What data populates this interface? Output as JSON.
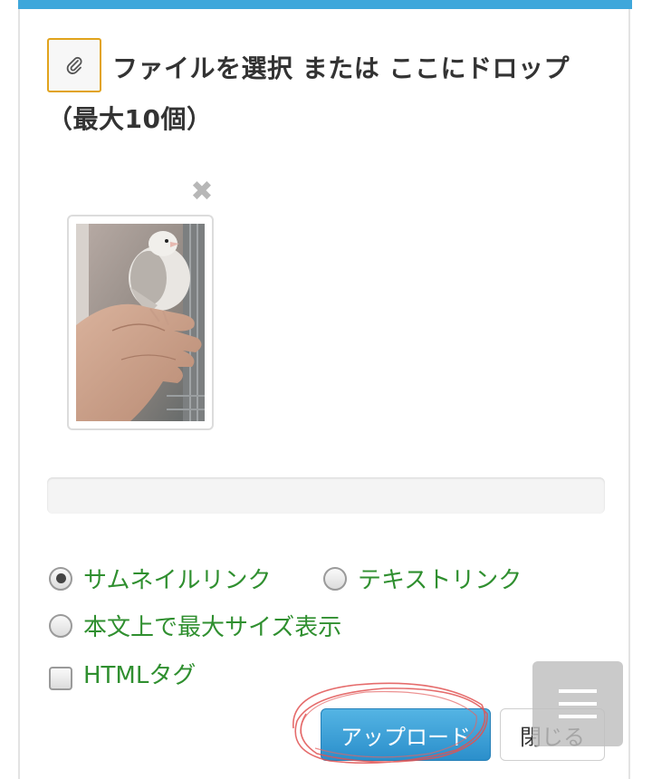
{
  "uploader": {
    "drop_text": "ファイルを選択 または ここにドロップ（最大10個）",
    "attach_icon": "paperclip-icon",
    "thumbnails": [
      {
        "remove_label": "✖",
        "image_alt": "bird-on-hand-photo"
      }
    ],
    "progress": 0
  },
  "options": {
    "thumbnail_link": {
      "label": "サムネイルリンク",
      "checked": true
    },
    "text_link": {
      "label": "テキストリンク",
      "checked": false
    },
    "max_size_display": {
      "label": "本文上で最大サイズ表示",
      "checked": false
    },
    "html_tag": {
      "label": "HTMLタグ",
      "checked": false
    }
  },
  "buttons": {
    "upload_label": "アップロード",
    "close_label": "閉じる"
  },
  "menu": {
    "icon": "hamburger-menu-icon"
  },
  "colors": {
    "accent": "#3ea7db",
    "option_text": "#2f8f2f",
    "attach_border": "#e1a31c",
    "annotation": "#e05252"
  }
}
